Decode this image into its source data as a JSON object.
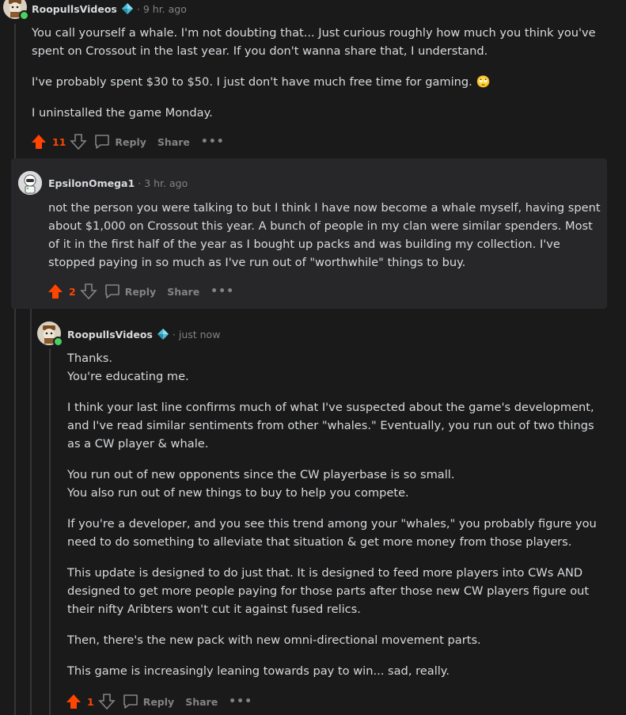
{
  "comments": [
    {
      "username": "RoopullsVideos",
      "flair_icon": "diamond-flair-icon",
      "timestamp": "9 hr. ago",
      "paragraphs": [
        "You call yourself a whale. I'm not doubting that... Just curious roughly how much you think you've spent on Crossout in the last year. If you don't wanna share that, I understand.",
        "I've probably spent $30 to $50. I just don't have much free time for gaming. 🙄",
        "I uninstalled the game Monday."
      ],
      "vote_count": "11",
      "reply_label": "Reply",
      "share_label": "Share",
      "more_label": "•••"
    },
    {
      "username": "EpsilonOmega1",
      "timestamp": "3 hr. ago",
      "paragraphs": [
        "not the person you were talking to but I think I have now become a whale myself, having spent about $1,000 on Crossout this year. A bunch of people in my clan were similar spenders. Most of it in the first half of the year as I bought up packs and was building my collection. I've stopped paying in so much as I've run out of \"worthwhile\" things to buy."
      ],
      "vote_count": "2",
      "reply_label": "Reply",
      "share_label": "Share",
      "more_label": "•••"
    },
    {
      "username": "RoopullsVideos",
      "flair_icon": "diamond-flair-icon",
      "timestamp": "just now",
      "paragraphs": [
        "Thanks.\nYou're educating me.",
        "I think your last line confirms much of what I've suspected about the game's development, and I've read similar sentiments from other \"whales.\" Eventually, you run out of two things as a CW player & whale.",
        "You run out of new opponents since the CW playerbase is so small.\nYou also run out of new things to buy to help you compete.",
        "If you're a developer, and you see this trend among your \"whales,\" you probably figure you need to do something to alleviate that situation & get more money from those players.",
        "This update is designed to do just that. It is designed to feed more players into CWs AND designed to get more people paying for those parts after those new CW players figure out their nifty Aribters won't cut it against fused relics.",
        "Then, there's the new pack with new omni-directional movement parts.",
        "This game is increasingly leaning towards pay to win... sad, really."
      ],
      "vote_count": "1",
      "reply_label": "Reply",
      "share_label": "Share",
      "more_label": "•••"
    }
  ],
  "colors": {
    "upvote": "#ff4500",
    "online": "#46d160",
    "flair": "#4fbcd6"
  }
}
